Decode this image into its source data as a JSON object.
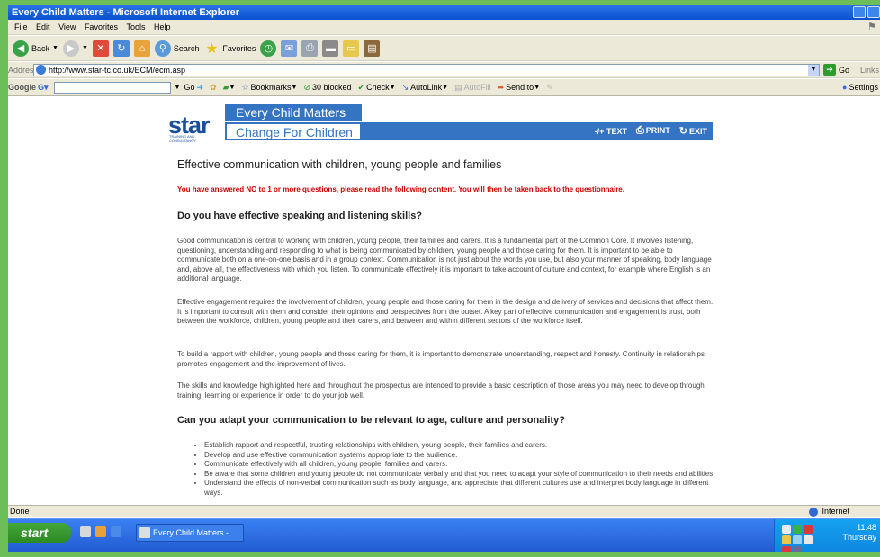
{
  "window": {
    "title": "Every Child Matters - Microsoft Internet Explorer"
  },
  "menubar": {
    "items": [
      "File",
      "Edit",
      "View",
      "Favorites",
      "Tools",
      "Help"
    ]
  },
  "toolbar": {
    "back_label": "Back",
    "search_label": "Search",
    "favorites_label": "Favorites"
  },
  "address": {
    "label": "Address",
    "url": "http://www.star-tc.co.uk/ECM/ecm.asp",
    "go_label": "Go",
    "links_label": "Links"
  },
  "googlebar": {
    "brand": "Google",
    "go_label": "Go",
    "bookmarks_label": "Bookmarks",
    "blocked_label": "30 blocked",
    "check_label": "Check",
    "autolink_label": "AutoLink",
    "autofill_label": "AutoFill",
    "sendto_label": "Send to",
    "settings_label": "Settings"
  },
  "banner": {
    "logo_text": "star",
    "logo_subtext": "TRAINING AND CONSULTANCY",
    "ecm_title": "Every Child Matters",
    "cfc_title": "Change For Children",
    "text_tool": "-/+ TEXT",
    "print_tool": "PRINT",
    "exit_tool": "EXIT"
  },
  "page": {
    "heading": "Effective communication with children, young people and families",
    "warning": "You have answered NO to 1 or more questions, please read the following content.  You will then be taken back to the questionnaire.",
    "section1_title": "Do you have effective speaking and listening skills?",
    "para1": "Good communication is central to working with children, young people, their families and carers. It is a fundamental part of the Common Core. It involves listening, questioning, understanding and responding to what is being communicated by children, young people and those caring for them. It is important to be able to communicate both on a one-on-one basis and in a group context. Communication is not just about the words you use, but also your manner of speaking, body language and, above all, the effectiveness with which you listen. To communicate effectively it is important to take account of culture and context, for example where English is an additional language.",
    "para2": "Effective engagement requires the involvement of children, young people and those caring for them in the design and delivery of services and decisions that affect them. It is important to consult with them and consider their opinions and perspectives from the outset. A key part of effective communication and engagement is trust, both between the workforce, children, young people and their carers, and between and within different sectors of the workforce itself.",
    "para3": "To build a rapport with children, young people and those caring for them, it is important to demonstrate understanding, respect and honesty. Continuity in relationships promotes engagement and the improvement of lives.",
    "para4": "The skills and knowledge highlighted here and throughout the prospectus are intended to provide a basic description of those areas you may need to develop through training, learning or experience in order to do your job well.",
    "section2_title": "Can you adapt your communication to be relevant to age, culture and personality?",
    "bullets": [
      "Establish rapport and respectful, trusting relationships with children, young people, their families and carers.",
      "Develop and use effective communication systems appropriate to the audience.",
      "Communicate effectively with all children, young people, families and carers.",
      "Be aware that some children and young people do not communicate verbally and that you need to adapt your style of communication to their needs and abilities.",
      "Understand the effects of non-verbal communication such as body language, and appreciate that different cultures use and interpret body language in different ways."
    ]
  },
  "status": {
    "text": "Done",
    "zone": "Internet"
  },
  "taskbar": {
    "start_label": "start",
    "task_item": "Every Child Matters - ...",
    "time": "11:48",
    "day": "Thursday"
  }
}
